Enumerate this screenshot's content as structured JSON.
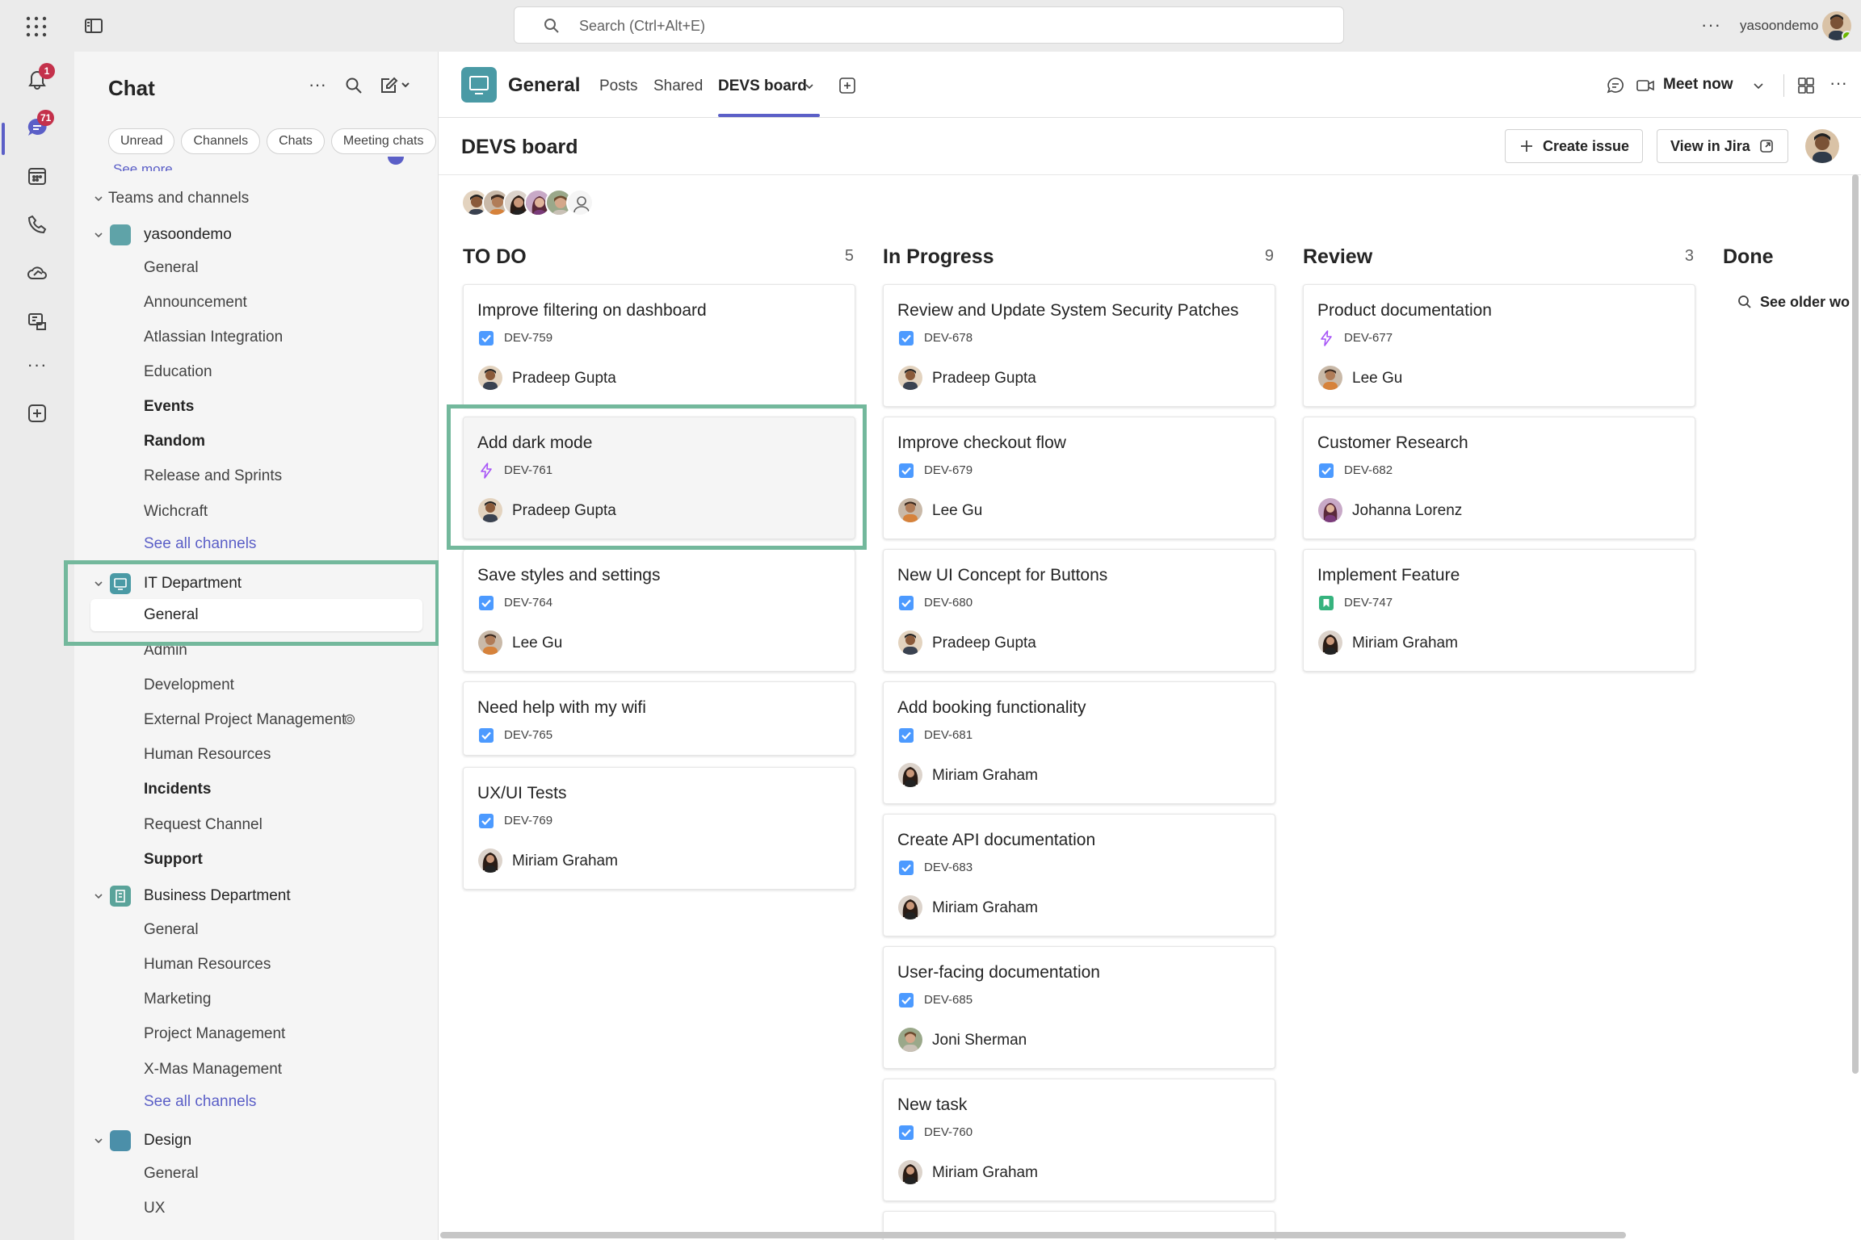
{
  "topbar": {
    "search_placeholder": "Search (Ctrl+Alt+E)",
    "more": "···",
    "username": "yasoondemo"
  },
  "rail": {
    "activity_badge": "1",
    "chat_badge": "71",
    "more": "···"
  },
  "chat_panel": {
    "title": "Chat",
    "filters": [
      "Unread",
      "Channels",
      "Chats",
      "Meeting chats"
    ],
    "see_more": "See more",
    "section_title": "Teams and channels",
    "teams": [
      {
        "name": "yasoondemo",
        "color": "#5fa3a8",
        "channels": [
          {
            "name": "General",
            "bold": false
          },
          {
            "name": "Announcement",
            "bold": false
          },
          {
            "name": "Atlassian Integration",
            "bold": false
          },
          {
            "name": "Education",
            "bold": false
          },
          {
            "name": "Events",
            "bold": true
          },
          {
            "name": "Random",
            "bold": true
          },
          {
            "name": "Release and Sprints",
            "bold": false
          },
          {
            "name": "Wichcraft",
            "bold": false
          }
        ],
        "see_all": "See all channels"
      },
      {
        "name": "IT Department",
        "color": "#4a9aa5",
        "channels": [
          {
            "name": "General",
            "bold": false,
            "selected": true
          },
          {
            "name": "Admin",
            "bold": false
          },
          {
            "name": "Development",
            "bold": false
          },
          {
            "name": "External Project Management",
            "bold": false,
            "shared_icon": true
          },
          {
            "name": "Human Resources",
            "bold": false
          },
          {
            "name": "Incidents",
            "bold": true
          },
          {
            "name": "Request Channel",
            "bold": false
          },
          {
            "name": "Support",
            "bold": true
          }
        ]
      },
      {
        "name": "Business Department",
        "color": "#5aa39a",
        "channels": [
          {
            "name": "General",
            "bold": false
          },
          {
            "name": "Human Resources",
            "bold": false
          },
          {
            "name": "Marketing",
            "bold": false
          },
          {
            "name": "Project Management",
            "bold": false
          },
          {
            "name": "X-Mas Management",
            "bold": false
          }
        ],
        "see_all": "See all channels"
      },
      {
        "name": "Design",
        "color": "#4b8fa9",
        "channels": [
          {
            "name": "General",
            "bold": false
          },
          {
            "name": "UX",
            "bold": false
          }
        ]
      }
    ]
  },
  "channel_header": {
    "name": "General",
    "tabs": [
      "Posts",
      "Shared",
      "DEVS board"
    ],
    "active_tab": "DEVS board",
    "meet_now": "Meet now"
  },
  "board": {
    "title": "DEVS board",
    "create_issue": "Create issue",
    "view_in_jira": "View in Jira",
    "see_older": "See older wo",
    "columns": [
      {
        "title": "TO DO",
        "count": "5",
        "cards": [
          {
            "title": "Improve filtering on dashboard",
            "key": "DEV-759",
            "type": "task",
            "assignee": "Pradeep Gupta",
            "avatar": "pradeep"
          },
          {
            "title": "Add dark mode",
            "key": "DEV-761",
            "type": "epic",
            "assignee": "Pradeep Gupta",
            "avatar": "pradeep",
            "hover": true
          },
          {
            "title": "Save styles and settings",
            "key": "DEV-764",
            "type": "task",
            "assignee": "Lee Gu",
            "avatar": "lee"
          },
          {
            "title": "Need help with my wifi",
            "key": "DEV-765",
            "type": "task",
            "assignee": "",
            "avatar": ""
          },
          {
            "title": "UX/UI Tests",
            "key": "DEV-769",
            "type": "task",
            "assignee": "Miriam Graham",
            "avatar": "miriam"
          }
        ]
      },
      {
        "title": "In Progress",
        "count": "9",
        "cards": [
          {
            "title": "Review and Update System Security Patches",
            "key": "DEV-678",
            "type": "task",
            "assignee": "Pradeep Gupta",
            "avatar": "pradeep"
          },
          {
            "title": "Improve checkout flow",
            "key": "DEV-679",
            "type": "task",
            "assignee": "Lee Gu",
            "avatar": "lee"
          },
          {
            "title": "New UI Concept for Buttons",
            "key": "DEV-680",
            "type": "task",
            "assignee": "Pradeep Gupta",
            "avatar": "pradeep"
          },
          {
            "title": "Add booking functionality",
            "key": "DEV-681",
            "type": "task",
            "assignee": "Miriam Graham",
            "avatar": "miriam"
          },
          {
            "title": "Create API documentation",
            "key": "DEV-683",
            "type": "task",
            "assignee": "Miriam Graham",
            "avatar": "miriam"
          },
          {
            "title": "User-facing documentation",
            "key": "DEV-685",
            "type": "task",
            "assignee": "Joni Sherman",
            "avatar": "joni"
          },
          {
            "title": "New task",
            "key": "DEV-760",
            "type": "task",
            "assignee": "Miriam Graham",
            "avatar": "miriam"
          }
        ]
      },
      {
        "title": "Review",
        "count": "3",
        "cards": [
          {
            "title": "Product documentation",
            "key": "DEV-677",
            "type": "epic",
            "assignee": "Lee Gu",
            "avatar": "lee"
          },
          {
            "title": "Customer Research",
            "key": "DEV-682",
            "type": "task",
            "assignee": "Johanna Lorenz",
            "avatar": "johanna"
          },
          {
            "title": "Implement Feature",
            "key": "DEV-747",
            "type": "story",
            "assignee": "Miriam Graham",
            "avatar": "miriam"
          }
        ]
      },
      {
        "title": "Done",
        "count": "",
        "cards": []
      }
    ]
  },
  "colors": {
    "accent": "#5b5fc7",
    "badge": "#c4314b",
    "highlight_box": "#73b89c",
    "task_icon": "#4c9aff",
    "epic_icon": "#a855f7",
    "story_icon": "#36b37e"
  }
}
